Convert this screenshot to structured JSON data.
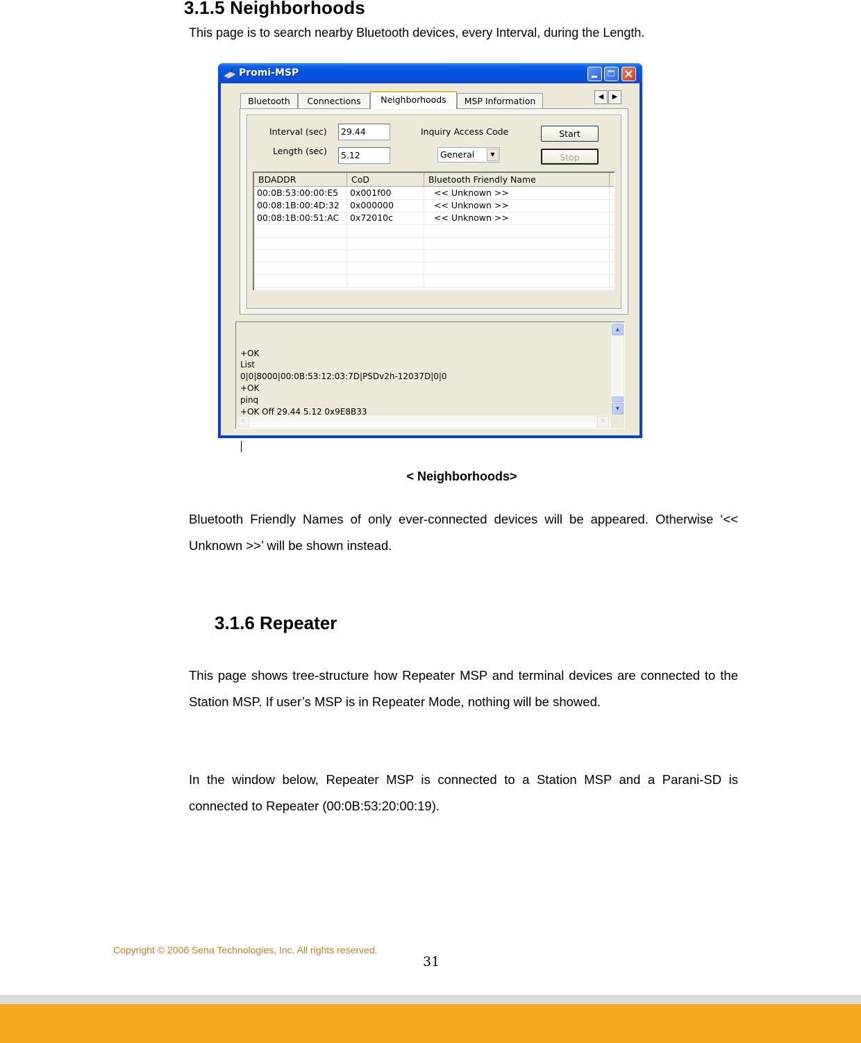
{
  "section_315": {
    "heading": "3.1.5 Neighborhoods",
    "intro": "This page is to search nearby Bluetooth devices, every Interval, during the Length.",
    "figure_caption": "< Neighborhoods>",
    "note": "Bluetooth Friendly Names of only ever-connected devices will be appeared. Otherwise ‘<< Unknown >>’ will be shown instead."
  },
  "window": {
    "title": "Promi-MSP",
    "title_icon": "bluetooth-device-icon",
    "controls": {
      "minimize": "minimize-icon",
      "maximize": "maximize-icon",
      "close": "close-icon"
    },
    "tabs": [
      {
        "label": "Bluetooth",
        "active": false
      },
      {
        "label": "Connections",
        "active": false
      },
      {
        "label": "Neighborhoods",
        "active": true
      },
      {
        "label": "MSP Information",
        "active": false
      }
    ],
    "tab_scroll": {
      "left": "◀",
      "right": "▶"
    },
    "form": {
      "interval_label": "Interval (sec)",
      "interval_value": "29.44",
      "length_label": "Length (sec)",
      "length_value": "5.12",
      "iac_label": "Inquiry Access Code",
      "iac_selected": "General",
      "start_label": "Start",
      "stop_label": "Stop"
    },
    "list": {
      "columns": [
        "BDADDR",
        "CoD",
        "Bluetooth Friendly Name"
      ],
      "rows": [
        [
          "00:0B:53:00:00:E5",
          "0x001f00",
          "<< Unknown >>"
        ],
        [
          "00:08:1B:00:4D:32",
          "0x000000",
          "<< Unknown >>"
        ],
        [
          "00:08:1B:00:51:AC",
          "0x72010c",
          "<< Unknown >>"
        ]
      ]
    },
    "log": {
      "lines": [
        "+OK",
        "List",
        "0|0|8000|00:0B:53:12:03:7D|PSDv2h-12037D|0|0",
        "+OK",
        "pinq",
        "+OK Off 29.44 5.12 0x9E8B33"
      ]
    }
  },
  "section_316": {
    "heading": "3.1.6 Repeater",
    "para1": "This page shows tree-structure how Repeater MSP and terminal devices are connected to the Station MSP. If user’s MSP is in Repeater Mode, nothing will be showed.",
    "para2": "In the window below, Repeater MSP is connected to a Station MSP and a Parani-SD is connected to Repeater (00:0B:53:20:00:19)."
  },
  "footer": {
    "copyright": "Copyright © 2006 Sena Technologies, Inc. All rights reserved.",
    "page_number": "31",
    "band_color": "#f7a823",
    "strip_color": "#dcdcdc"
  }
}
